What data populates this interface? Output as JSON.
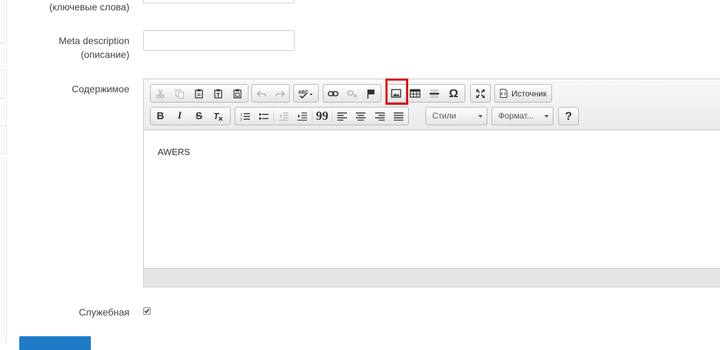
{
  "form": {
    "keywords_label": "(ключевые слова)",
    "keywords_value": "",
    "meta_description_label_line1": "Meta description",
    "meta_description_label_line2": "(описание)",
    "meta_description_value": "",
    "content_label": "Содержимое",
    "service_label": "Служебная",
    "service_checked": true
  },
  "editor": {
    "content_text": "AWERS",
    "source_label": "Источник",
    "styles_label": "Стили",
    "format_label": "Формат...",
    "help_label": "?",
    "bold_label": "B",
    "italic_label": "I",
    "strike_label": "S",
    "removeformat_label": "Tx",
    "special_char_label": "Ω",
    "blockquote_label": "99",
    "highlighted_button": "image-button"
  },
  "colors": {
    "highlight": "#dd0000",
    "submit_button": "#1f7bc8"
  }
}
